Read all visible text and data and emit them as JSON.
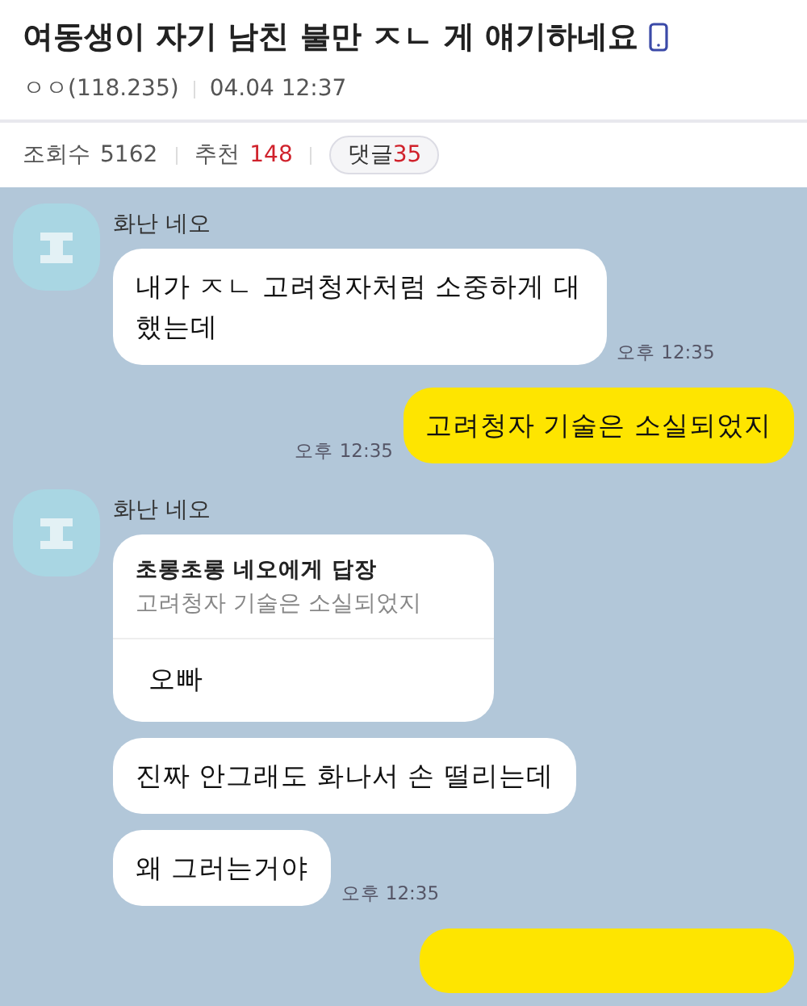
{
  "post": {
    "title": "여동생이 자기 남친 불만 ㅈㄴ 게 얘기하네요",
    "author": "ㅇㅇ(118.235)",
    "date": "04.04 12:37",
    "views_label": "조회수",
    "views": "5162",
    "recommend_label": "추천",
    "recommend": "148",
    "comments_label": "댓글",
    "comments": "35"
  },
  "chat": {
    "groups": [
      {
        "kind": "received",
        "name": "화난 네오",
        "messages": [
          {
            "kind": "text",
            "text": "내가 ㅈㄴ  고려청자처럼 소중하게 대했는데",
            "time": "오후 12:35"
          }
        ]
      },
      {
        "kind": "sent",
        "messages": [
          {
            "kind": "text",
            "text": "고려청자 기술은 소실되었지",
            "time": "오후 12:35"
          }
        ]
      },
      {
        "kind": "received",
        "name": "화난 네오",
        "messages": [
          {
            "kind": "reply",
            "reply_to": "초롱초롱 네오에게 답장",
            "quote": "고려청자 기술은 소실되었지",
            "text": "오빠"
          },
          {
            "kind": "text",
            "text": "진짜 안그래도 화나서 손 떨리는데"
          },
          {
            "kind": "text",
            "text": "왜 그러는거야",
            "time": "오후 12:35"
          }
        ]
      },
      {
        "kind": "sent",
        "messages": [
          {
            "kind": "cut"
          }
        ]
      }
    ]
  }
}
